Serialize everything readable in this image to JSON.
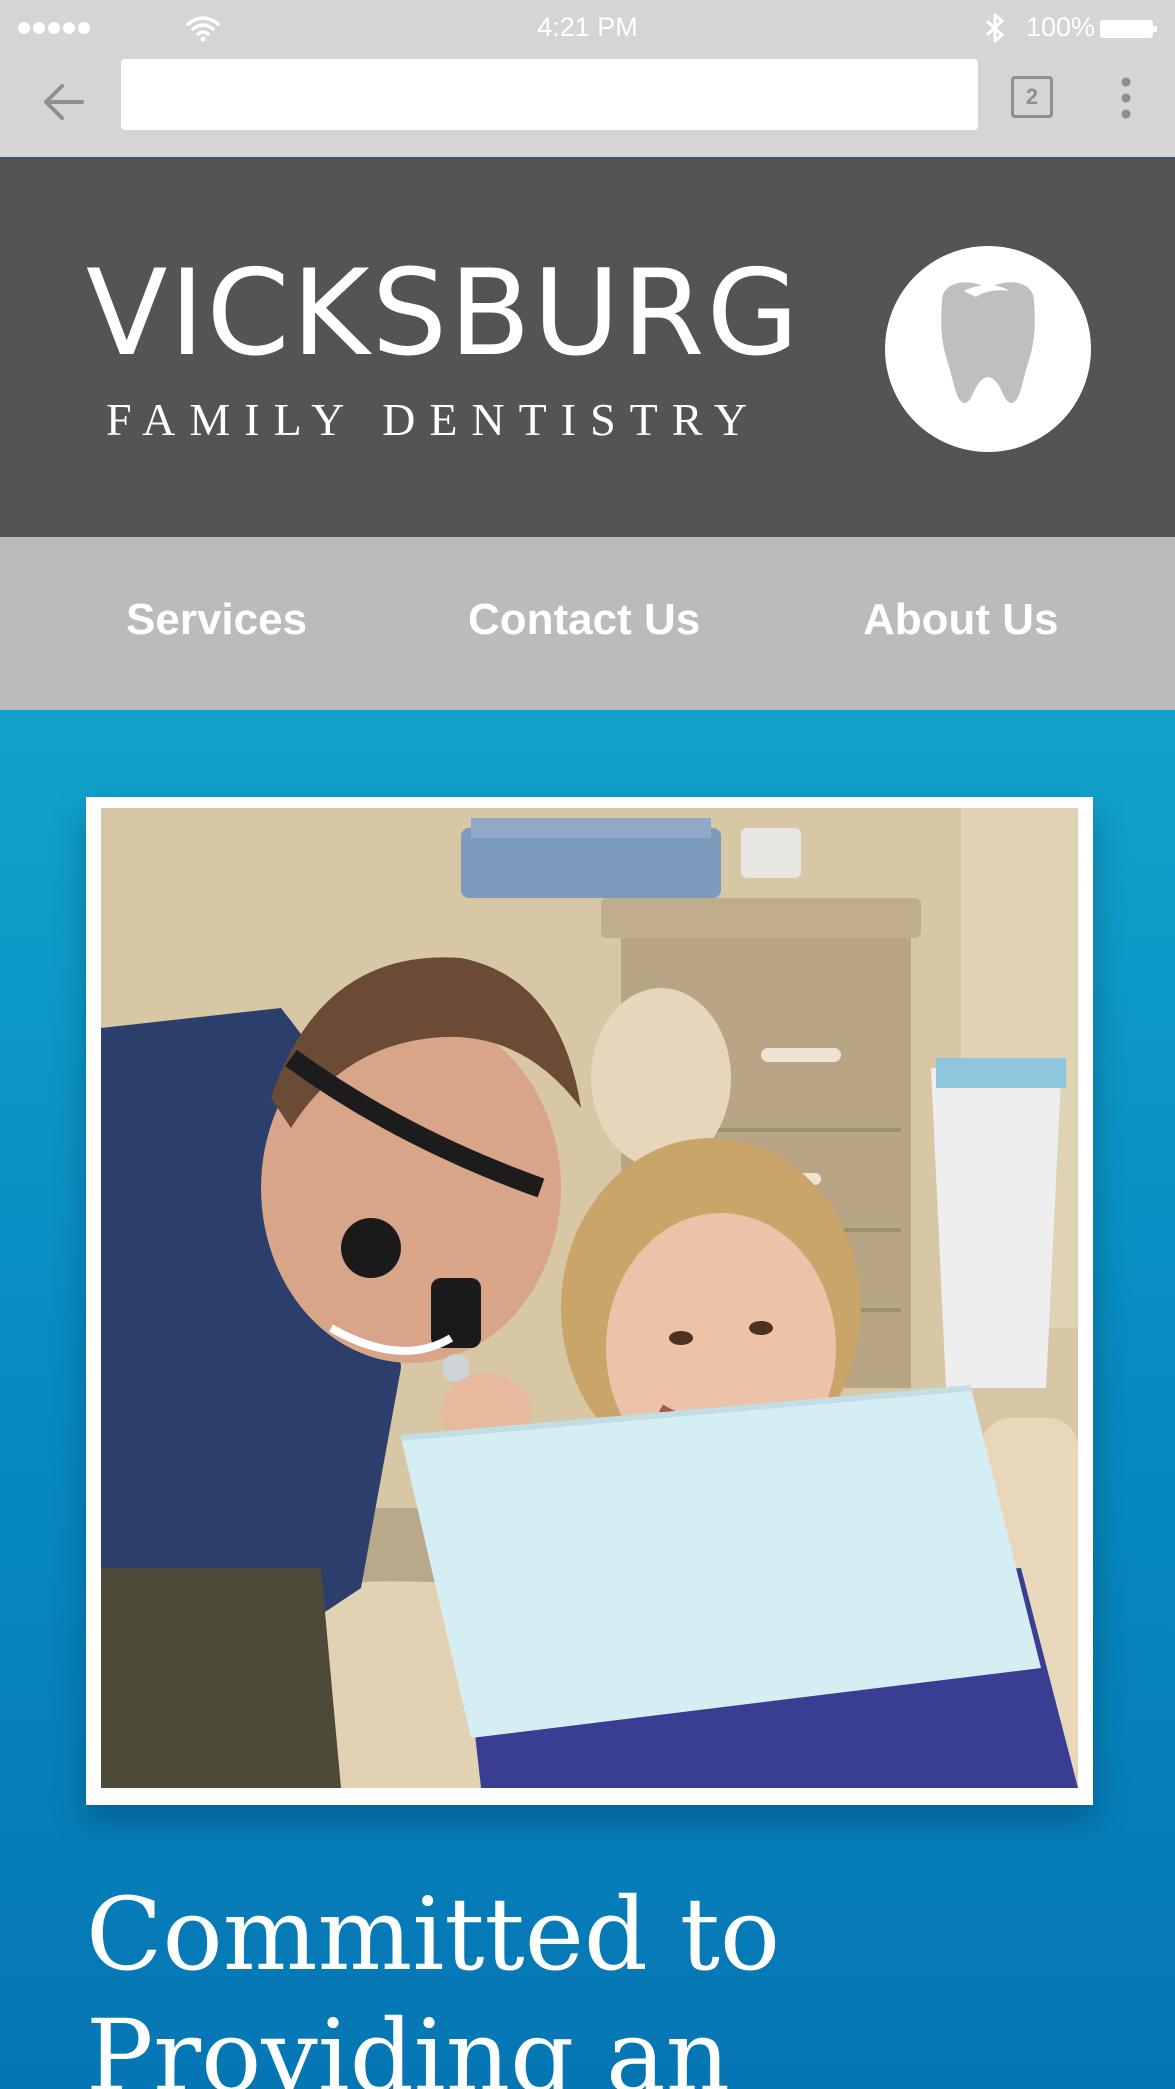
{
  "status_bar": {
    "time": "4:21 PM",
    "battery": "100%",
    "icons": [
      "signal-dots-icon",
      "wifi-icon",
      "bluetooth-icon",
      "battery-icon"
    ]
  },
  "browser": {
    "url_value": "",
    "tab_count": "2",
    "icons": [
      "back-arrow-icon",
      "tabs-icon",
      "overflow-menu-icon"
    ]
  },
  "header": {
    "logo_title": "VICKSBURG",
    "logo_subtitle": "FAMILY DENTISTRY",
    "logo_icon": "tooth-icon"
  },
  "nav": {
    "items": [
      {
        "label": "Services"
      },
      {
        "label": "Contact Us"
      },
      {
        "label": "About Us"
      }
    ]
  },
  "hero": {
    "heading": "Committed to Providing an"
  },
  "colors": {
    "status_bar_bg": "#d5d5d5",
    "header_bg": "#545454",
    "nav_bg": "#bbbbbd",
    "hero_top": "#11a3cc",
    "hero_bottom": "#0576b4",
    "tooth_fill": "#bfbfc1"
  }
}
